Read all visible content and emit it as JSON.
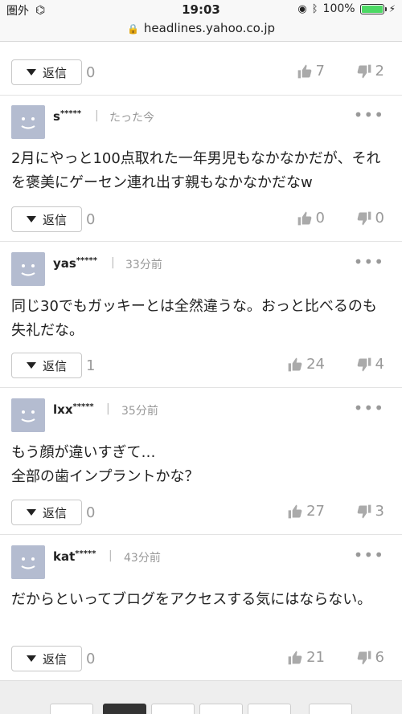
{
  "status_bar": {
    "carrier": "圏外",
    "time": "19:03",
    "battery": "100%",
    "battery_level": 1.0
  },
  "url_bar": {
    "host": "headlines.yahoo.co.jp"
  },
  "reply_label": "返信",
  "top_actions": {
    "reply_count": "0",
    "likes": "7",
    "dislikes": "2"
  },
  "comments": [
    {
      "user": "s",
      "mask": "*****",
      "time": "たった今",
      "text": "2月にやっと100点取れた一年男児もなかなかだが、それを褒美にゲーセン連れ出す親もなかなかだなw",
      "reply_count": "0",
      "likes": "0",
      "dislikes": "0"
    },
    {
      "user": "yas",
      "mask": "*****",
      "time": "33分前",
      "text": "同じ30でもガッキーとは全然違うな。おっと比べるのも失礼だな。",
      "reply_count": "1",
      "likes": "24",
      "dislikes": "4"
    },
    {
      "user": "lxx",
      "mask": "*****",
      "time": "35分前",
      "text_lines": [
        "もう顔が違いすぎて…",
        "全部の歯インプラントかな？"
      ],
      "reply_count": "0",
      "likes": "27",
      "dislikes": "3"
    },
    {
      "user": "kat",
      "mask": "*****",
      "time": "43分前",
      "text": "だからといってブログをアクセスする気にはならない。",
      "reply_count": "0",
      "likes": "21",
      "dislikes": "6"
    }
  ]
}
